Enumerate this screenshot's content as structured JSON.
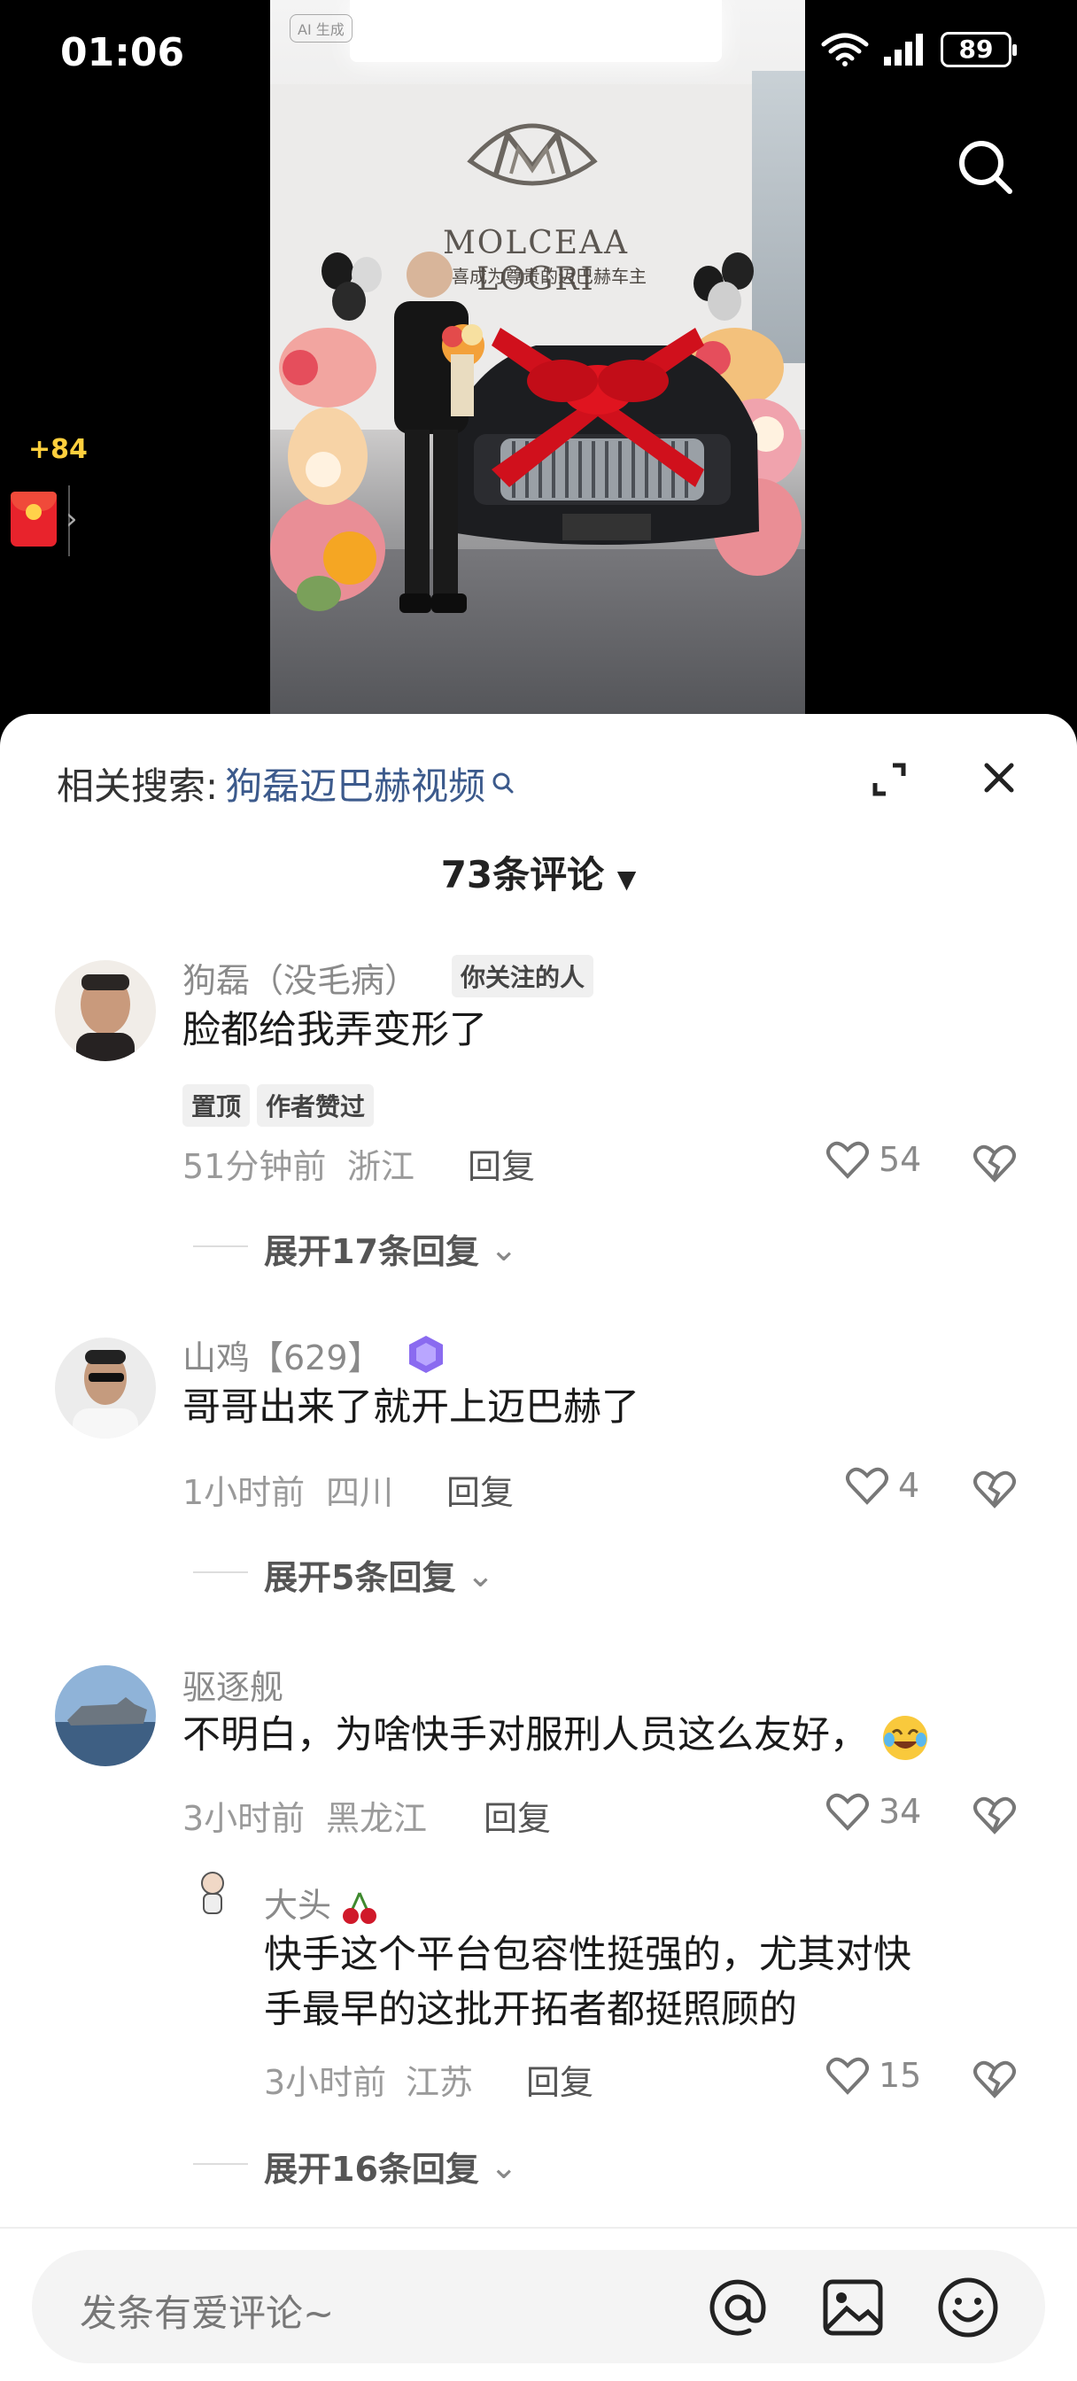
{
  "status_bar": {
    "time": "01:06",
    "battery": "89"
  },
  "video": {
    "ai_badge": "AI 生成",
    "brand_sign": "MOLCEAA LOGRI",
    "banner": "恭喜成为尊贵的迈巴赫车主",
    "coin_reward": "+84"
  },
  "panel": {
    "related_label": "相关搜索:",
    "related_keyword": "狗磊迈巴赫视频",
    "comment_count": "73条评论"
  },
  "comments": [
    {
      "username": "狗磊（没毛病）",
      "follow_badge": "你关注的人",
      "text": "脸都给我弄变形了",
      "tags": [
        "置顶",
        "作者赞过"
      ],
      "time": "51分钟前",
      "location": "浙江",
      "reply": "回复",
      "likes": "54",
      "expand": "展开17条回复"
    },
    {
      "username": "山鸡【629】",
      "text": "哥哥出来了就开上迈巴赫了",
      "time": "1小时前",
      "location": "四川",
      "reply": "回复",
      "likes": "4",
      "expand": "展开5条回复"
    },
    {
      "username": "驱逐舰",
      "text": "不明白，为啥快手对服刑人员这么友好，",
      "time": "3小时前",
      "location": "黑龙江",
      "reply": "回复",
      "likes": "34",
      "sub_reply": {
        "username": "大头",
        "text_line1": "快手这个平台包容性挺强的，尤其对快",
        "text_line2": "手最早的这批开拓者都挺照顾的",
        "time": "3小时前",
        "location": "江苏",
        "reply": "回复",
        "likes": "15"
      },
      "expand": "展开16条回复"
    }
  ],
  "input": {
    "placeholder": "发条有爱评论~"
  }
}
